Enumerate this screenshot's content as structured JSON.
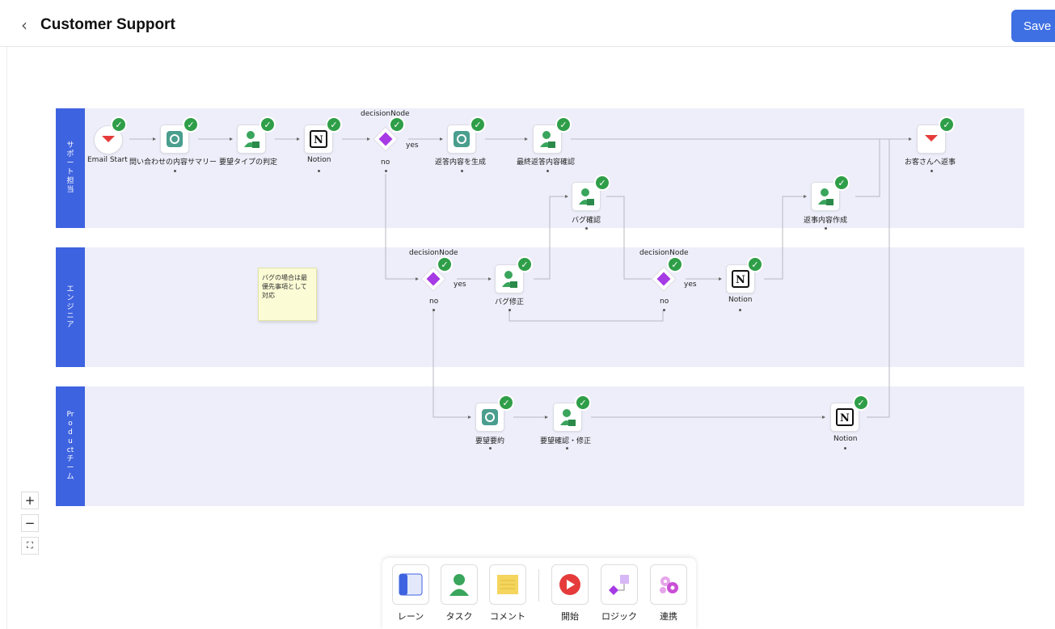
{
  "header": {
    "back_icon": "chevron-left-icon",
    "title": "Customer Support",
    "save_label": "Save"
  },
  "lanes": [
    {
      "label": "サポート担当"
    },
    {
      "label": "エンジニア"
    },
    {
      "label": "Productチーム"
    }
  ],
  "nodes": {
    "email_start": "Email Start",
    "inquiry_summary": "問い合わせの内容サマリー",
    "request_type": "要望タイプの判定",
    "notion1": "Notion",
    "decision1_title": "decisionNode",
    "decision1_no": "no",
    "decision1_yes": "yes",
    "generate_reply": "返答内容を生成",
    "final_check": "最終返答内容確認",
    "reply_customer": "お客さんへ返事",
    "bug_check": "バグ確認",
    "reply_create": "返事内容作成",
    "decision2_title": "decisionNode",
    "decision2_yes": "yes",
    "decision2_no": "no",
    "bug_fix": "バグ修正",
    "decision3_title": "decisionNode",
    "decision3_yes": "yes",
    "decision3_no": "no",
    "notion2": "Notion",
    "request_summary": "要望要約",
    "request_confirm": "要望確認・修正",
    "notion3": "Notion"
  },
  "sticky_note": "バグの場合は最優先事項として対応",
  "zoom": {
    "in": "+",
    "out": "−",
    "fit": "⛶"
  },
  "toolbar": {
    "lane": "レーン",
    "task": "タスク",
    "comment": "コメント",
    "start": "開始",
    "logic": "ロジック",
    "integration": "連携"
  },
  "colors": {
    "accent": "#3e63e0",
    "save": "#3e6fe3",
    "check": "#2f9e48",
    "decision": "#a63be5",
    "lane_bg": "#edeef9"
  }
}
